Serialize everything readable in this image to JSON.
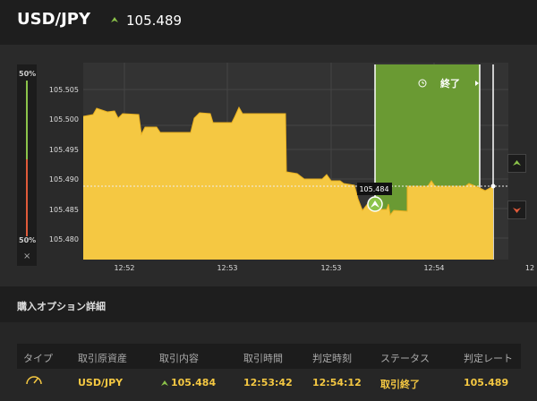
{
  "header": {
    "pair": "USD/JPY",
    "price": "105.489",
    "trend_icon": "triangle-up-icon",
    "trend_color": "#8bc34a"
  },
  "gauge": {
    "top_label": "50%",
    "bottom_label": "50%",
    "close": "×",
    "up_color": "#8bc34a",
    "down_color": "#e05a3a"
  },
  "chart": {
    "y_ticks": [
      "105.505",
      "105.500",
      "105.495",
      "105.490",
      "105.485",
      "105.480"
    ],
    "x_ticks": [
      "12:52",
      "12:53",
      "12:53",
      "12:54",
      "12"
    ],
    "price_tag": "105.484",
    "end_label": "終了",
    "area_color": "#f5c842",
    "zone_color": "#6a9a33"
  },
  "section": {
    "title": "購入オプション詳細"
  },
  "table": {
    "headers": [
      "タイプ",
      "取引原資産",
      "取引内容",
      "取引時間",
      "判定時刻",
      "ステータス",
      "判定レート"
    ],
    "row": {
      "asset": "USD/JPY",
      "content": "105.484",
      "trade_time": "12:53:42",
      "judge_time": "12:54:12",
      "status": "取引終了",
      "rate": "105.489"
    }
  }
}
